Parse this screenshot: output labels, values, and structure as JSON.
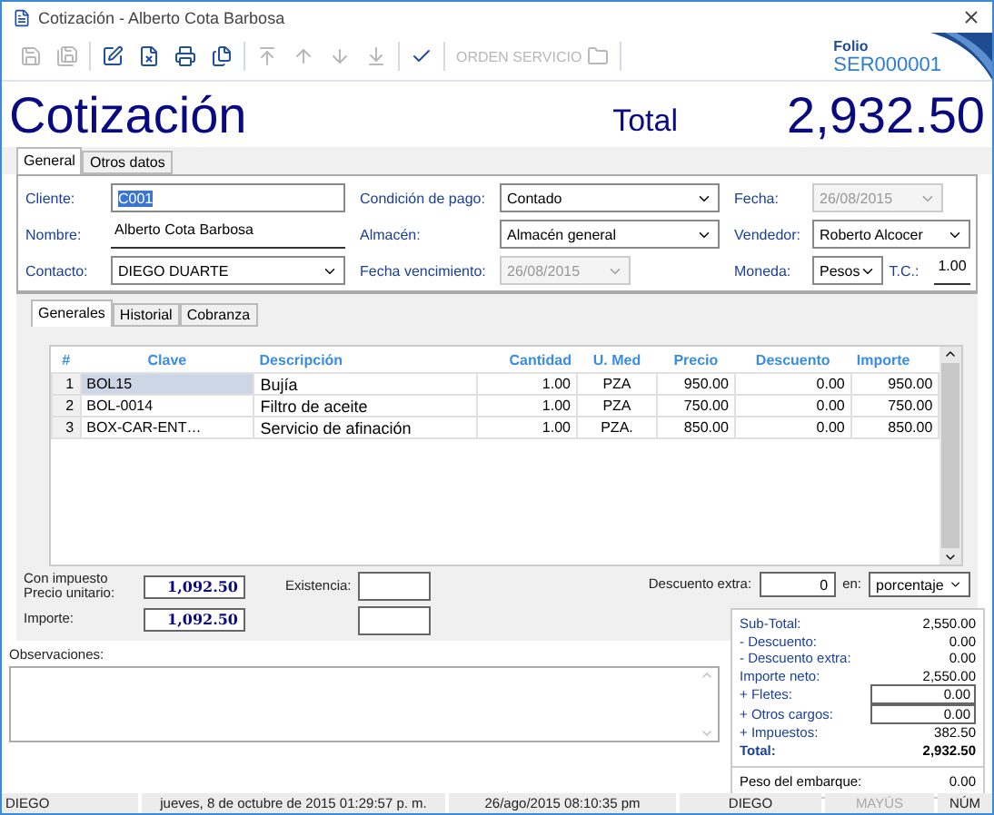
{
  "window": {
    "title": "Cotización - Alberto Cota Barbosa"
  },
  "toolbar": {
    "groups": [
      [
        {
          "disabled": true
        },
        {
          "disabled": true
        }
      ],
      [
        {
          "disabled": false
        },
        {
          "disabled": false
        },
        {
          "disabled": false
        },
        {
          "disabled": false
        }
      ],
      [
        {
          "disabled": true
        },
        {
          "disabled": true
        },
        {
          "disabled": true
        },
        {
          "disabled": true
        }
      ],
      [
        {
          "disabled": false
        }
      ],
      [
        {
          "label": "ORDEN SERVICIO",
          "disabled": true
        }
      ]
    ]
  },
  "folio": {
    "label": "Folio",
    "value": "SER000001"
  },
  "header": {
    "title": "Cotización",
    "total_label": "Total",
    "total": "2,932.50"
  },
  "top_tabs": [
    {
      "label": "General",
      "selected": true
    },
    {
      "label": "Otros datos",
      "selected": false
    }
  ],
  "form": {
    "columns": [
      [
        [
          {
            "label": "Cliente:",
            "value": "C001",
            "kind": "text",
            "highlighted": true
          }
        ],
        [
          {
            "label": "Nombre:",
            "value": "Alberto Cota Barbosa",
            "kind": "underline"
          }
        ],
        [
          {
            "label": "Contacto:",
            "value": "DIEGO DUARTE",
            "kind": "combo"
          }
        ]
      ],
      [
        [
          {
            "label": "Condición de pago:",
            "value": "Contado",
            "kind": "combo"
          }
        ],
        [
          {
            "label": "Almacén:",
            "value": "Almacén general",
            "kind": "combo"
          }
        ],
        [
          {
            "label": "Fecha vencimiento:",
            "value": "26/08/2015",
            "kind": "date",
            "disabled": true
          }
        ]
      ],
      [
        [
          {
            "label": "Fecha:",
            "value": "26/08/2015",
            "kind": "date",
            "disabled": true
          }
        ],
        [
          {
            "label": "Vendedor:",
            "value": "Roberto Alcocer",
            "kind": "combo"
          }
        ],
        [
          {
            "label": "Moneda:",
            "value": "Pesos",
            "kind": "combo"
          },
          {
            "label": "T.C.:",
            "value": "1.00",
            "kind": "underline"
          }
        ]
      ]
    ]
  },
  "detail_tabs": [
    {
      "label": "Generales",
      "selected": true
    },
    {
      "label": "Historial",
      "selected": false
    },
    {
      "label": "Cobranza",
      "selected": false
    }
  ],
  "table": {
    "columns": [
      {
        "label": "#"
      },
      {
        "label": "Clave"
      },
      {
        "label": "Descripción"
      },
      {
        "label": "Cantidad"
      },
      {
        "label": "U. Med"
      },
      {
        "label": "Precio"
      },
      {
        "label": "Descuento"
      },
      {
        "label": "Importe"
      }
    ],
    "rows": [
      {
        "selected": true,
        "cells": [
          "1",
          "BOL15",
          "Bujía",
          "1.00",
          "PZA",
          "950.00",
          "0.00",
          "950.00"
        ]
      },
      {
        "selected": false,
        "cells": [
          "2",
          "BOL-0014",
          "Filtro de aceite",
          "1.00",
          "PZA",
          "750.00",
          "0.00",
          "750.00"
        ]
      },
      {
        "selected": false,
        "cells": [
          "3",
          "BOX-CAR-ENT…",
          "Servicio de afinación",
          "1.00",
          "PZA.",
          "850.00",
          "0.00",
          "850.00"
        ]
      }
    ]
  },
  "line": {
    "tax_label": "Con impuesto",
    "unit_label": "Precio unitario:",
    "unit_price": "1,092.50",
    "amount_label": "Importe:",
    "amount": "1,092.50",
    "stock_label": "Existencia:",
    "extra_discount_label": "Descuento extra:",
    "extra_discount": "0",
    "in_label": "en:",
    "in_value": "porcentaje"
  },
  "notes": {
    "label": "Observaciones:"
  },
  "totals": {
    "lines": [
      {
        "label": "Sub-Total:",
        "value": "2,550.00",
        "kind": "plain"
      },
      {
        "label": "- Descuento:",
        "value": "0.00",
        "kind": "plain"
      },
      {
        "label": "- Descuento extra:",
        "value": "0.00",
        "kind": "plain"
      },
      {
        "label": "Importe neto:",
        "value": "2,550.00",
        "kind": "plain"
      },
      {
        "label": "+ Fletes:",
        "value": "0.00",
        "kind": "input"
      },
      {
        "label": "+ Otros cargos:",
        "value": "0.00",
        "kind": "input"
      },
      {
        "label": "+ Impuestos:",
        "value": "382.50",
        "kind": "plain"
      },
      {
        "label": "Total:",
        "value": "2,932.50",
        "kind": "total"
      }
    ],
    "weight_label": "Peso del embarque:",
    "weight": "0.00"
  },
  "status_bar": [
    {
      "text": "DIEGO",
      "disabled": false
    },
    {
      "text": "jueves, 8 de octubre de 2015 01:29:57 p. m.",
      "disabled": false
    },
    {
      "text": "26/ago/2015 08:10:35 pm",
      "disabled": false
    },
    {
      "text": "DIEGO",
      "disabled": false
    },
    {
      "text": "MAYÚS",
      "disabled": true
    },
    {
      "text": "NÚM",
      "disabled": false
    }
  ]
}
